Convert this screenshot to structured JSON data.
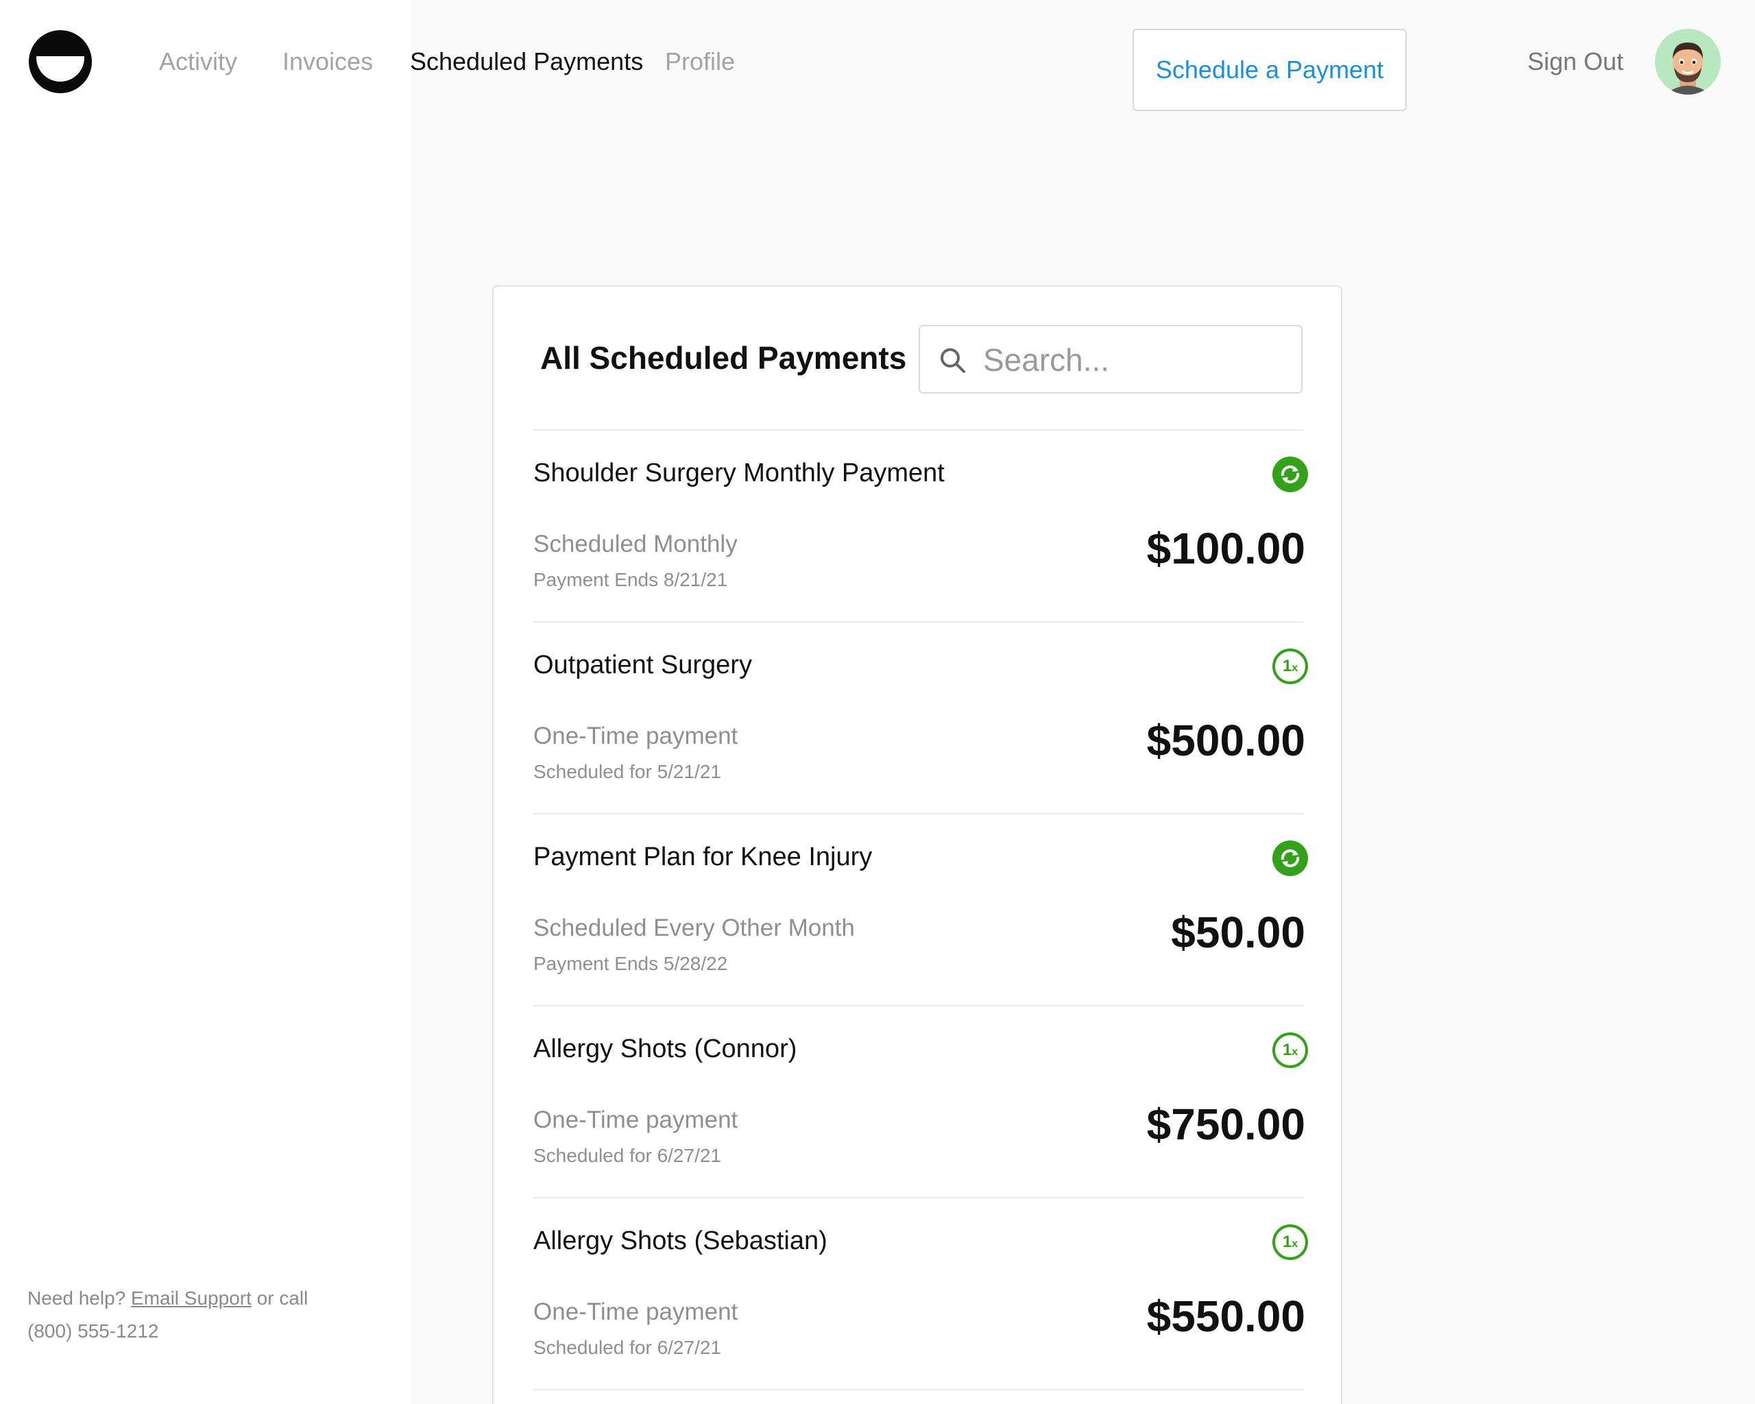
{
  "nav": {
    "items": [
      {
        "label": "Activity",
        "active": false
      },
      {
        "label": "Invoices",
        "active": false
      },
      {
        "label": "Scheduled Payments",
        "active": true
      },
      {
        "label": "Profile",
        "active": false
      }
    ],
    "schedule_button": "Schedule a Payment",
    "sign_out": "Sign Out"
  },
  "help": {
    "prefix": "Need help?",
    "link": "Email Support",
    "suffix": "or call (800) 555-1212"
  },
  "card": {
    "title": "All Scheduled Payments",
    "search_placeholder": "Search..."
  },
  "payments": [
    {
      "name": "Shoulder Surgery Monthly Payment",
      "type": "Scheduled Monthly",
      "detail": "Payment Ends 8/21/21",
      "amount": "$100.00",
      "icon": "recurring-icon"
    },
    {
      "name": "Outpatient Surgery",
      "type": "One-Time payment",
      "detail": "Scheduled for 5/21/21",
      "amount": "$500.00",
      "icon": "one-time-icon"
    },
    {
      "name": "Payment Plan for Knee Injury",
      "type": "Scheduled Every Other Month",
      "detail": "Payment Ends 5/28/22",
      "amount": "$50.00",
      "icon": "recurring-icon"
    },
    {
      "name": "Allergy Shots (Connor)",
      "type": "One-Time payment",
      "detail": "Scheduled for 6/27/21",
      "amount": "$750.00",
      "icon": "one-time-icon"
    },
    {
      "name": "Allergy Shots (Sebastian)",
      "type": "One-Time payment",
      "detail": "Scheduled for 6/27/21",
      "amount": "$550.00",
      "icon": "one-time-icon"
    }
  ],
  "colors": {
    "accent_blue": "#1a8fe0",
    "status_green": "#34a11a",
    "muted_text": "#8f8f8f"
  }
}
